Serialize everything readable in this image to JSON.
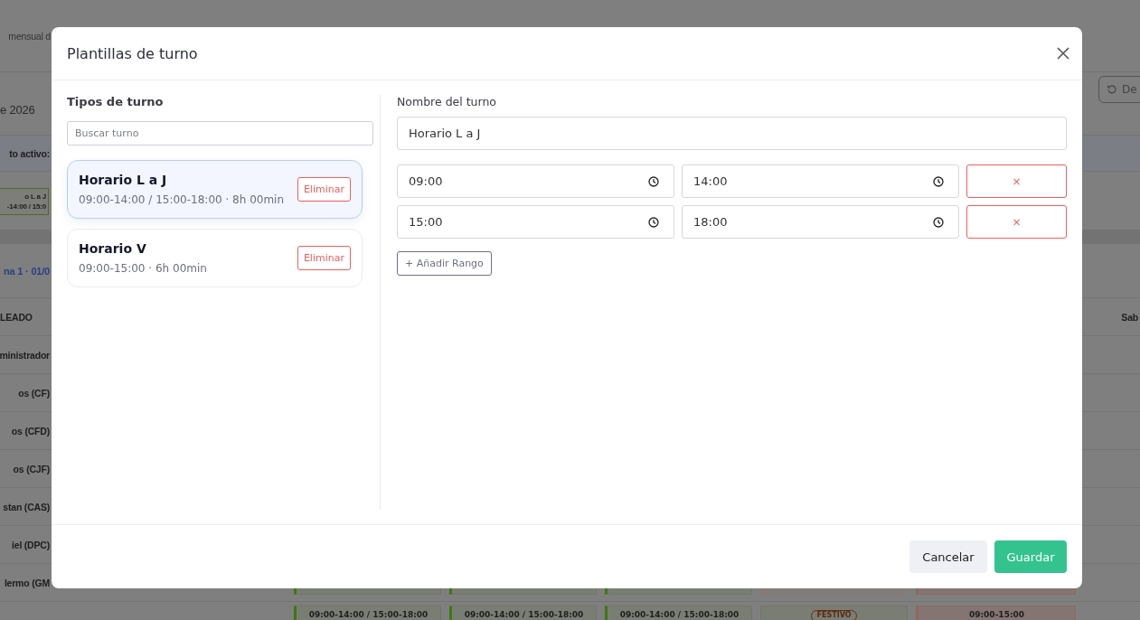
{
  "background": {
    "page_title": "mensual d",
    "date": "e 2026",
    "active_label": "to activo:",
    "shift_chip": {
      "name": "o L a J",
      "hours": "-14:00 / 15:0"
    },
    "week_title": "na 1 · 01/0",
    "column_header": "LEADO",
    "day_header": "Sab",
    "reset_button": "De",
    "employees": [
      "ministrador",
      "os (CF)",
      "os (CFD)",
      "os (CJF)",
      "stan (CAS)",
      "iel (DPC)",
      "lermo (GM"
    ],
    "bottom_cells": [
      {
        "kind": "shift",
        "text": "09:00-14:00 / 15:00-18:00"
      },
      {
        "kind": "shift",
        "text": "09:00-14:00 / 15:00-18:00"
      },
      {
        "kind": "shift",
        "text": "09:00-14:00 / 15:00-18:00"
      },
      {
        "kind": "holiday",
        "text": "FESTIVO"
      },
      {
        "kind": "alert",
        "text": "09:00-15:00"
      }
    ]
  },
  "modal": {
    "title": "Plantillas de turno",
    "list": {
      "heading": "Tipos de turno",
      "search": {
        "placeholder": "Buscar turno"
      },
      "items": [
        {
          "name": "Horario L a J",
          "summary": "09:00-14:00 / 15:00-18:00 · 8h 00min",
          "delete_label": "Eliminar",
          "selected": true
        },
        {
          "name": "Horario V",
          "summary": "09:00-15:00 · 6h 00min",
          "delete_label": "Eliminar",
          "selected": false
        }
      ]
    },
    "editor": {
      "name_label": "Nombre del turno",
      "name_value": "Horario L a J",
      "ranges": [
        {
          "start": "09:00",
          "end": "14:00",
          "remove_label": "×"
        },
        {
          "start": "15:00",
          "end": "18:00",
          "remove_label": "×"
        }
      ],
      "add_button": "+ Añadir Rango"
    },
    "footer": {
      "cancel": "Cancelar",
      "save": "Guardar"
    }
  }
}
